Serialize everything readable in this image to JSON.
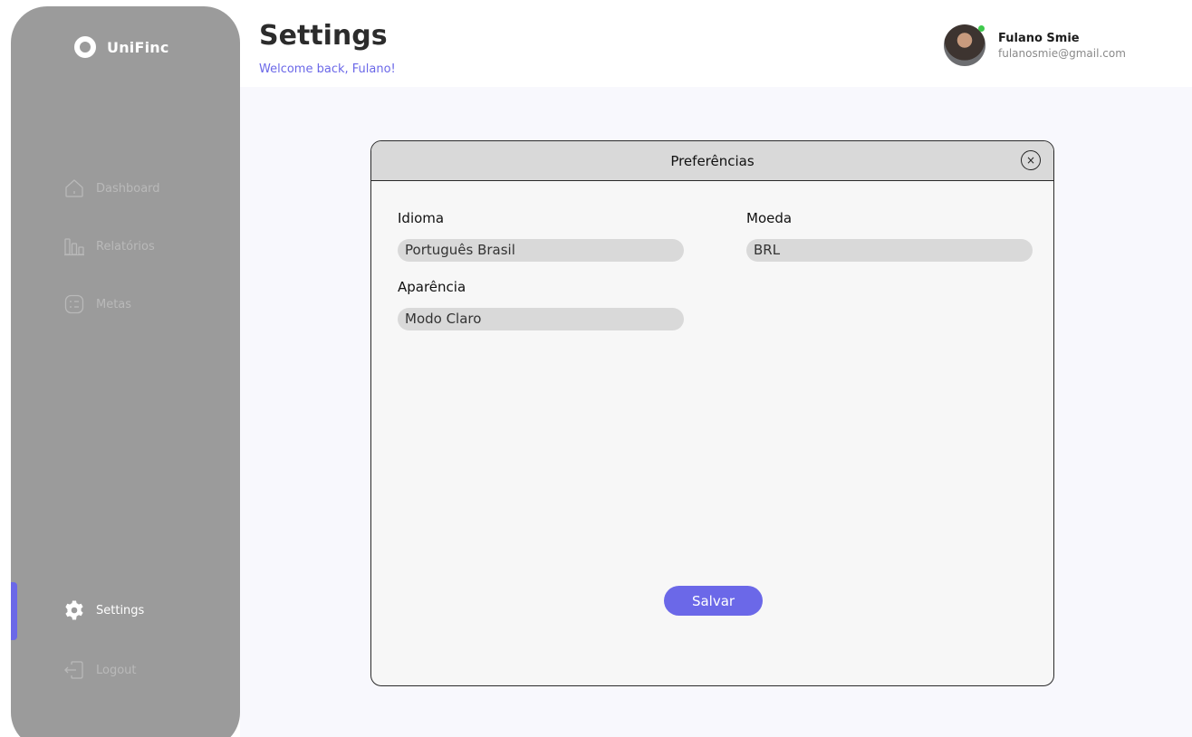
{
  "app": {
    "name": "UniFinc"
  },
  "sidebar": {
    "items": [
      {
        "label": "Dashboard",
        "icon": "home-icon"
      },
      {
        "label": "Relatórios",
        "icon": "bar-chart-icon"
      },
      {
        "label": "Metas",
        "icon": "target-list-icon"
      }
    ],
    "settings_label": "Settings",
    "logout_label": "Logout"
  },
  "header": {
    "title": "Settings",
    "subtitle": "Welcome back, Fulano!"
  },
  "user": {
    "name": "Fulano Smie",
    "email": "fulanosmie@gmail.com",
    "status_color": "#3ec94c"
  },
  "modal": {
    "title": "Preferências",
    "close_symbol": "×",
    "fields": {
      "language": {
        "label": "Idioma",
        "value": "Português Brasil"
      },
      "currency": {
        "label": "Moeda",
        "value": "BRL"
      },
      "appearance": {
        "label": "Aparência",
        "value": "Modo Claro"
      }
    },
    "save_label": "Salvar"
  },
  "colors": {
    "accent": "#6b68e8",
    "sidebar_bg": "#9b9b9b",
    "modal_header_bg": "#d9d9d9"
  }
}
